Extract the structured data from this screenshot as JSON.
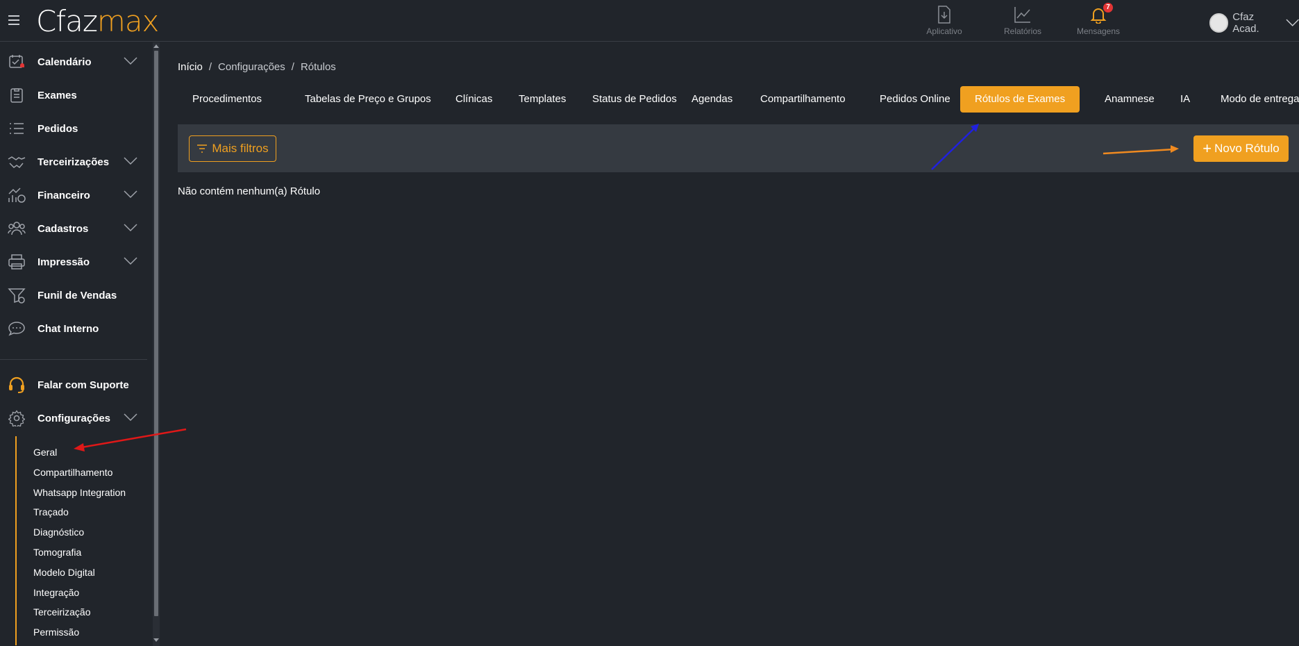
{
  "header": {
    "logo_part1": "Cfaz",
    "logo_part2": "max",
    "buttons": [
      {
        "label": "Aplicativo",
        "icon": "download-file-icon"
      },
      {
        "label": "Relatórios",
        "icon": "chart-trend-icon"
      },
      {
        "label": "Mensagens",
        "icon": "bell-icon",
        "badge": "7"
      }
    ],
    "user": {
      "name": "Cfaz Acad."
    }
  },
  "sidebar": {
    "items": [
      {
        "label": "Calendário",
        "icon": "calendar-icon",
        "expandable": true
      },
      {
        "label": "Exames",
        "icon": "clipboard-icon",
        "expandable": false
      },
      {
        "label": "Pedidos",
        "icon": "list-icon",
        "expandable": false
      },
      {
        "label": "Terceirizações",
        "icon": "handshake-icon",
        "expandable": true
      },
      {
        "label": "Financeiro",
        "icon": "finance-icon",
        "expandable": true
      },
      {
        "label": "Cadastros",
        "icon": "users-icon",
        "expandable": true
      },
      {
        "label": "Impressão",
        "icon": "printer-icon",
        "expandable": true
      },
      {
        "label": "Funil de Vendas",
        "icon": "funnel-icon",
        "expandable": false
      },
      {
        "label": "Chat Interno",
        "icon": "chat-icon",
        "expandable": false
      }
    ],
    "support": {
      "label": "Falar com Suporte",
      "icon": "headset-icon"
    },
    "settings": {
      "label": "Configurações",
      "icon": "gear-icon"
    },
    "sub_items": [
      "Geral",
      "Compartilhamento",
      "Whatsapp Integration",
      "Traçado",
      "Diagnóstico",
      "Tomografia",
      "Modelo Digital",
      "Integração",
      "Terceirização",
      "Permissão"
    ]
  },
  "breadcrumb": [
    "Início",
    "Configurações",
    "Rótulos"
  ],
  "tabs": [
    "Procedimentos",
    "Tabelas de Preço e Grupos",
    "Clínicas",
    "Templates",
    "Status de Pedidos",
    "Agendas",
    "Compartilhamento",
    "Pedidos Online",
    "Rótulos de Exames",
    "Anamnese",
    "IA",
    "Modo de entrega"
  ],
  "active_tab": "Rótulos de Exames",
  "toolbar": {
    "filter_label": "Mais filtros",
    "new_label": "Novo Rótulo"
  },
  "empty_message": "Não contém nenhum(a) Rótulo",
  "colors": {
    "accent": "#f0a020",
    "background": "#21252b",
    "toolbar_bg": "#353a41",
    "badge": "#e23535"
  }
}
